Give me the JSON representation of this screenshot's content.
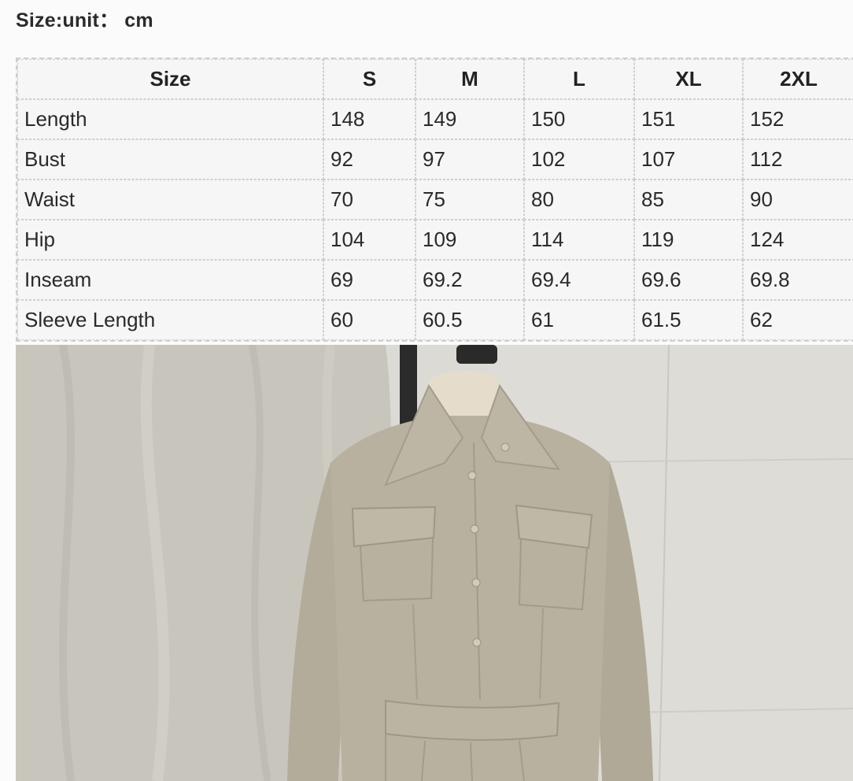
{
  "header": {
    "title": "Size:unit： cm"
  },
  "size_table": {
    "columns": [
      "Size",
      "S",
      "M",
      "L",
      "XL",
      "2XL"
    ],
    "rows": [
      {
        "label": "Length",
        "values": [
          "148",
          "149",
          "150",
          "151",
          "152"
        ]
      },
      {
        "label": "Bust",
        "values": [
          "92",
          "97",
          "102",
          "107",
          "112"
        ]
      },
      {
        "label": "Waist",
        "values": [
          "70",
          "75",
          "80",
          "85",
          "90"
        ]
      },
      {
        "label": "Hip",
        "values": [
          "104",
          "109",
          "114",
          "119",
          "124"
        ]
      },
      {
        "label": "Inseam",
        "values": [
          "69",
          "69.2",
          "69.4",
          "69.6",
          "69.8"
        ]
      },
      {
        "label": "Sleeve Length",
        "values": [
          "60",
          "60.5",
          "61",
          "61.5",
          "62"
        ]
      }
    ]
  },
  "product_photo": {
    "subject": "khaki button-front shirt dress with collar, chest flap pockets and belt on a dress form",
    "colors": {
      "garment": "#b7b09f",
      "backdrop_cloth": "#c9c6bd",
      "wall": "#dcdad4"
    }
  }
}
